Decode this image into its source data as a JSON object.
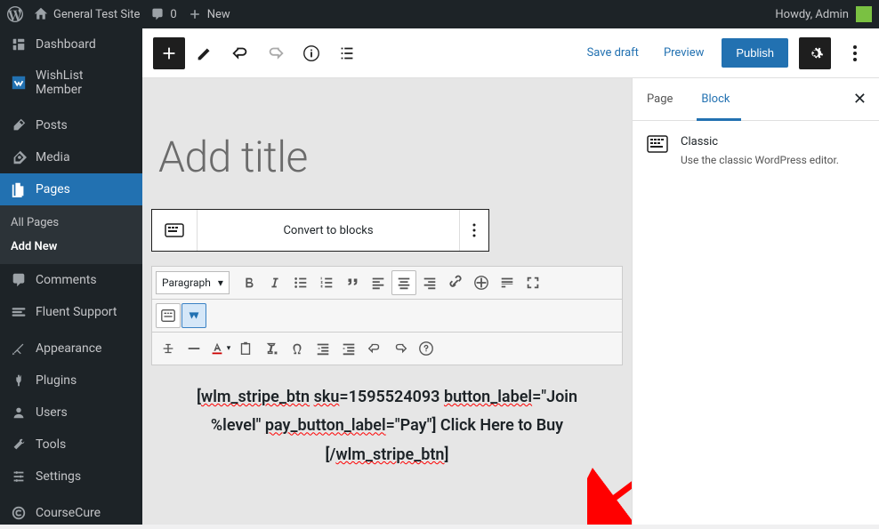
{
  "adminbar": {
    "site_name": "General Test Site",
    "comments_count": "0",
    "new_label": "New",
    "greeting": "Howdy, Admin"
  },
  "sidebar": {
    "items": [
      {
        "id": "dashboard",
        "label": "Dashboard"
      },
      {
        "id": "wishlist",
        "label": "WishList Member"
      },
      {
        "id": "posts",
        "label": "Posts"
      },
      {
        "id": "media",
        "label": "Media"
      },
      {
        "id": "pages",
        "label": "Pages",
        "active": true,
        "sub": [
          "All Pages",
          "Add New"
        ],
        "sub_current": "Add New"
      },
      {
        "id": "comments",
        "label": "Comments"
      },
      {
        "id": "fluent",
        "label": "Fluent Support"
      },
      {
        "id": "appearance",
        "label": "Appearance"
      },
      {
        "id": "plugins",
        "label": "Plugins"
      },
      {
        "id": "users",
        "label": "Users"
      },
      {
        "id": "tools",
        "label": "Tools"
      },
      {
        "id": "settings",
        "label": "Settings"
      },
      {
        "id": "coursecure",
        "label": "CourseCure"
      }
    ]
  },
  "editor_toolbar": {
    "save_draft": "Save draft",
    "preview": "Preview",
    "publish": "Publish"
  },
  "canvas": {
    "title_placeholder": "Add title",
    "convert_label": "Convert to blocks",
    "paragraph_label": "Paragraph",
    "shortcode_line1_a": "[",
    "shortcode_line1_b": "wlm_stripe_btn",
    "shortcode_line1_c": " ",
    "shortcode_line1_d": "sku",
    "shortcode_line1_e": "=1595524093 ",
    "shortcode_line1_f": "button_label",
    "shortcode_line1_g": "=\"Join",
    "shortcode_line2_a": "%level\" ",
    "shortcode_line2_b": "pay_button_label",
    "shortcode_line2_c": "=\"Pay\"] Click Here to Buy",
    "shortcode_line3_a": "[/",
    "shortcode_line3_b": "wlm_stripe_btn",
    "shortcode_line3_c": "]"
  },
  "inspector": {
    "tab_page": "Page",
    "tab_block": "Block",
    "block_title": "Classic",
    "block_desc": "Use the classic WordPress editor."
  }
}
